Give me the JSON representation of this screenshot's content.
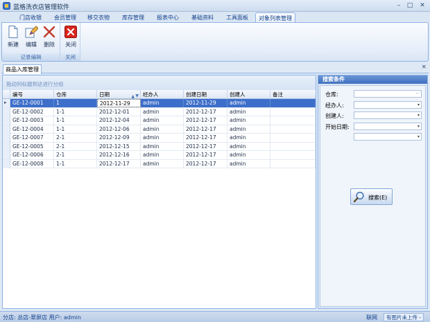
{
  "window": {
    "title": "蓝格洗衣店管理软件",
    "controls": {
      "minimize": "–",
      "maximize": "□",
      "close": "✕"
    }
  },
  "ribbon": {
    "tabs": [
      {
        "label": "门店收银"
      },
      {
        "label": "会员管理"
      },
      {
        "label": "移交衣物"
      },
      {
        "label": "库存管理"
      },
      {
        "label": "报表中心"
      },
      {
        "label": "基础资料"
      },
      {
        "label": "工具面板"
      },
      {
        "label": "对象列表管理",
        "active": true
      }
    ],
    "groups": {
      "record_edit": {
        "label": "记录编辑",
        "buttons": {
          "new": "新建",
          "edit": "编辑",
          "delete": "删除"
        }
      },
      "close": {
        "label": "关闭",
        "buttons": {
          "close": "关闭"
        }
      }
    },
    "icons": {
      "new": "new-document-icon",
      "edit": "edit-pencil-icon",
      "delete": "delete-x-icon",
      "close": "close-red-icon"
    },
    "colors": {
      "delete": "#c0392b",
      "close": "#d9251d"
    }
  },
  "document": {
    "tab_label": "商品入库管理",
    "close_glyph": "×"
  },
  "grid": {
    "group_hint": "拖动列标题到这进行分组",
    "columns": [
      "编号",
      "仓库",
      "日期",
      "经办人",
      "创建日期",
      "创建人",
      "备注"
    ],
    "sort_glyph": "▲",
    "filter_glyph": "▼",
    "row_indicator": "▸",
    "rows": [
      [
        "GE-12-0001",
        "1",
        "2012-11-29",
        "admin",
        "2012-11-29",
        "admin",
        ""
      ],
      [
        "GE-12-0002",
        "1-1",
        "2012-12-01",
        "admin",
        "2012-12-17",
        "admin",
        ""
      ],
      [
        "GE-12-0003",
        "1-1",
        "2012-12-04",
        "admin",
        "2012-12-17",
        "admin",
        ""
      ],
      [
        "GE-12-0004",
        "1-1",
        "2012-12-06",
        "admin",
        "2012-12-17",
        "admin",
        ""
      ],
      [
        "GE-12-0007",
        "2-1",
        "2012-12-09",
        "admin",
        "2012-12-17",
        "admin",
        ""
      ],
      [
        "GE-12-0005",
        "2-1",
        "2012-12-15",
        "admin",
        "2012-12-17",
        "admin",
        ""
      ],
      [
        "GE-12-0006",
        "2-1",
        "2012-12-16",
        "admin",
        "2012-12-17",
        "admin",
        ""
      ],
      [
        "GE-12-0008",
        "1-1",
        "2012-12-17",
        "admin",
        "2012-12-17",
        "admin",
        ""
      ]
    ],
    "selected_row": 0,
    "selected_color": "#3d6ec9"
  },
  "search_panel": {
    "title": "搜索条件",
    "fields": [
      {
        "label": "仓库:",
        "value": "",
        "glyph": "···"
      },
      {
        "label": "经办人:",
        "value": "",
        "glyph": "▾"
      },
      {
        "label": "创建人:",
        "value": "",
        "glyph": "▾"
      },
      {
        "label": "开始日期:",
        "value": "",
        "glyph": "▾"
      },
      {
        "label": "",
        "value": "",
        "glyph": "▾"
      }
    ],
    "search_button": "搜索(E)",
    "search_icon": "magnifier-icon"
  },
  "statusbar": {
    "left": "分店: 总店-翠屏店  用户: admin",
    "network": " 联网",
    "upload": "有图片未上传 -"
  }
}
